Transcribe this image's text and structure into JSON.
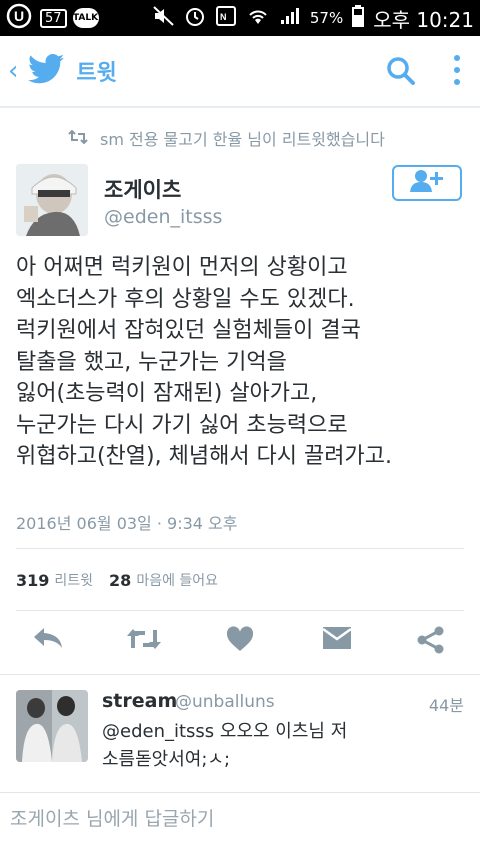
{
  "status_bar": {
    "notification_count": "57",
    "talk_label": "TALK",
    "battery": "57%",
    "time": "오후 10:21"
  },
  "app_bar": {
    "title": "트윗"
  },
  "tweet": {
    "retweet_note": "sm 전용 물고기 한율 님이 리트윗했습니다",
    "author_name": "조게이츠",
    "author_handle": "@eden_itsss",
    "text_lines": [
      "아 어쩌면 럭키원이 먼저의 상황이고",
      "엑소더스가 후의 상황일 수도 있겠다.",
      "럭키원에서 잡혀있던 실험체들이 결국",
      "탈출을 했고, 누군가는 기억을",
      "잃어(초능력이 잠재된) 살아가고,",
      "누군가는 다시 가기 싫어 초능력으로",
      "위협하고(찬열), 체념해서 다시 끌려가고."
    ],
    "timestamp": "2016년 06월 03일 · 9:34 오후",
    "retweet_count": "319",
    "retweet_label": "리트윗",
    "like_count": "28",
    "like_label": "마음에 들어요"
  },
  "reply": {
    "name": "stream",
    "handle": "@unballuns",
    "time": "44분",
    "text_line1": "@eden_itsss 오오오 이츠님 저",
    "text_line2": "소름돋앗서여;ㅅ;"
  },
  "compose": {
    "placeholder": "조게이츠 님에게 답글하기"
  },
  "colors": {
    "brand": "#55acee",
    "text": "#292f33",
    "muted": "#8899a6",
    "divider": "#e1e8ed",
    "action_icon": "#8899a6"
  }
}
